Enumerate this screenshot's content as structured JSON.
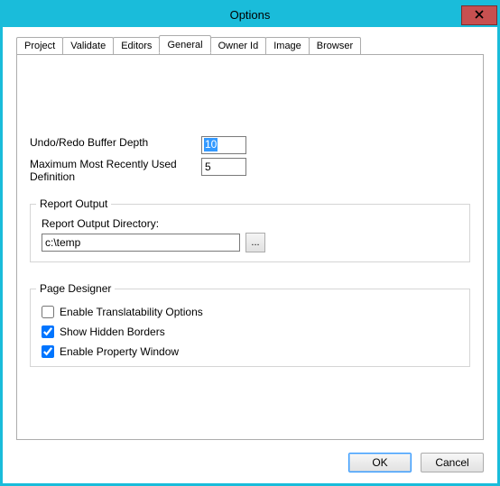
{
  "window": {
    "title": "Options"
  },
  "tabs": {
    "project": "Project",
    "validate": "Validate",
    "editors": "Editors",
    "general": "General",
    "ownerid": "Owner Id",
    "image": "Image",
    "browser": "Browser"
  },
  "general": {
    "undo_label": "Undo/Redo Buffer Depth",
    "undo_value": "10",
    "mru_label": "Maximum Most Recently Used Definition",
    "mru_value": "5",
    "report_legend": "Report Output",
    "report_dir_label": "Report Output Directory:",
    "report_dir_value": "c:\\temp",
    "browse_label": "...",
    "page_legend": "Page Designer",
    "chk_translate": "Enable Translatability Options",
    "chk_hidden": "Show Hidden Borders",
    "chk_propwin": "Enable Property Window",
    "chk_translate_checked": false,
    "chk_hidden_checked": true,
    "chk_propwin_checked": true
  },
  "buttons": {
    "ok": "OK",
    "cancel": "Cancel"
  }
}
